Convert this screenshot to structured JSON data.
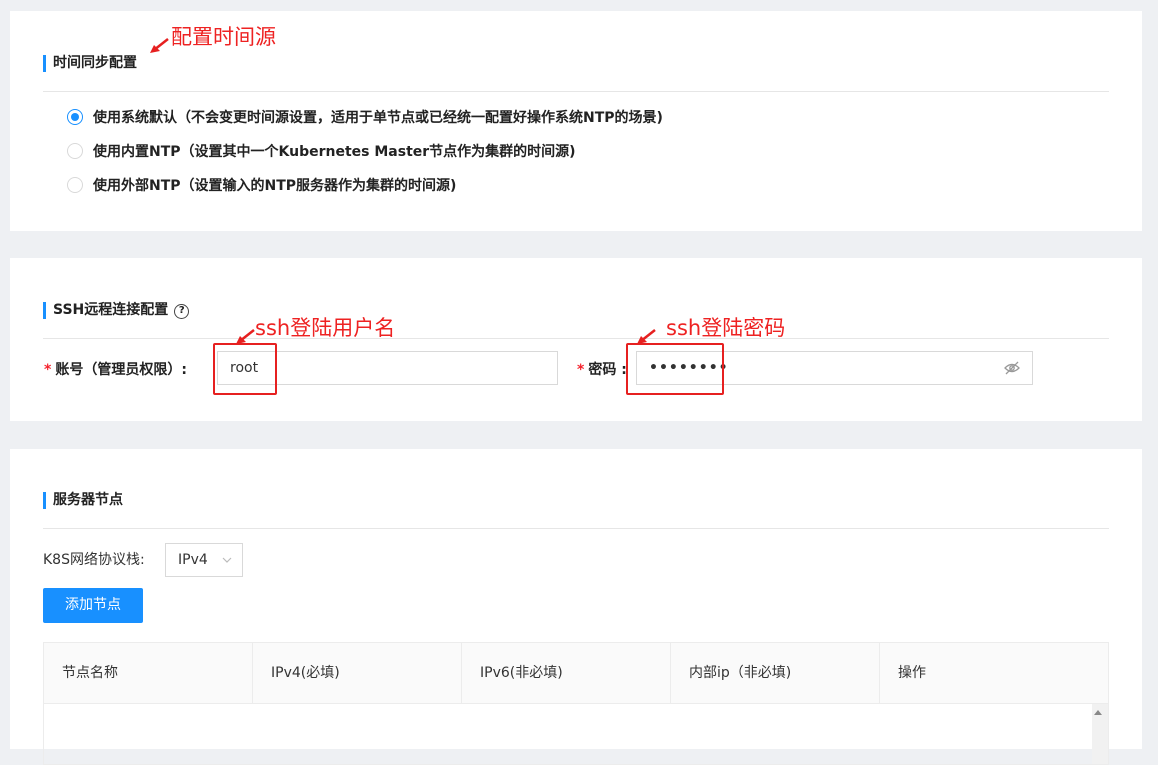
{
  "annotations": {
    "ntp": "配置时间源",
    "username": "ssh登陆用户名",
    "password": "ssh登陆密码",
    "color": "#e62020"
  },
  "ntp_section": {
    "title": "时间同步配置",
    "options": [
      {
        "label": "使用系统默认（不会变更时间源设置，适用于单节点或已经统一配置好操作系统NTP的场景)",
        "checked": true
      },
      {
        "label": "使用内置NTP（设置其中一个Kubernetes Master节点作为集群的时间源)",
        "checked": false
      },
      {
        "label": "使用外部NTP（设置输入的NTP服务器作为集群的时间源)",
        "checked": false
      }
    ]
  },
  "ssh_section": {
    "title": "SSH远程连接配置",
    "help_icon": "question-circle-icon",
    "account_label": "账号（管理员权限）:",
    "account_value": "root",
    "password_label": "密码 :",
    "password_value": "••••••••",
    "required_mark": "*"
  },
  "nodes_section": {
    "title": "服务器节点",
    "protocol_label": "K8S网络协议栈:",
    "protocol_value": "IPv4",
    "add_button": "添加节点",
    "columns": [
      "节点名称",
      "IPv4(必填)",
      "IPv6(非必填)",
      "内部ip（非必填)",
      "操作"
    ]
  },
  "accent_color": "#1890ff"
}
